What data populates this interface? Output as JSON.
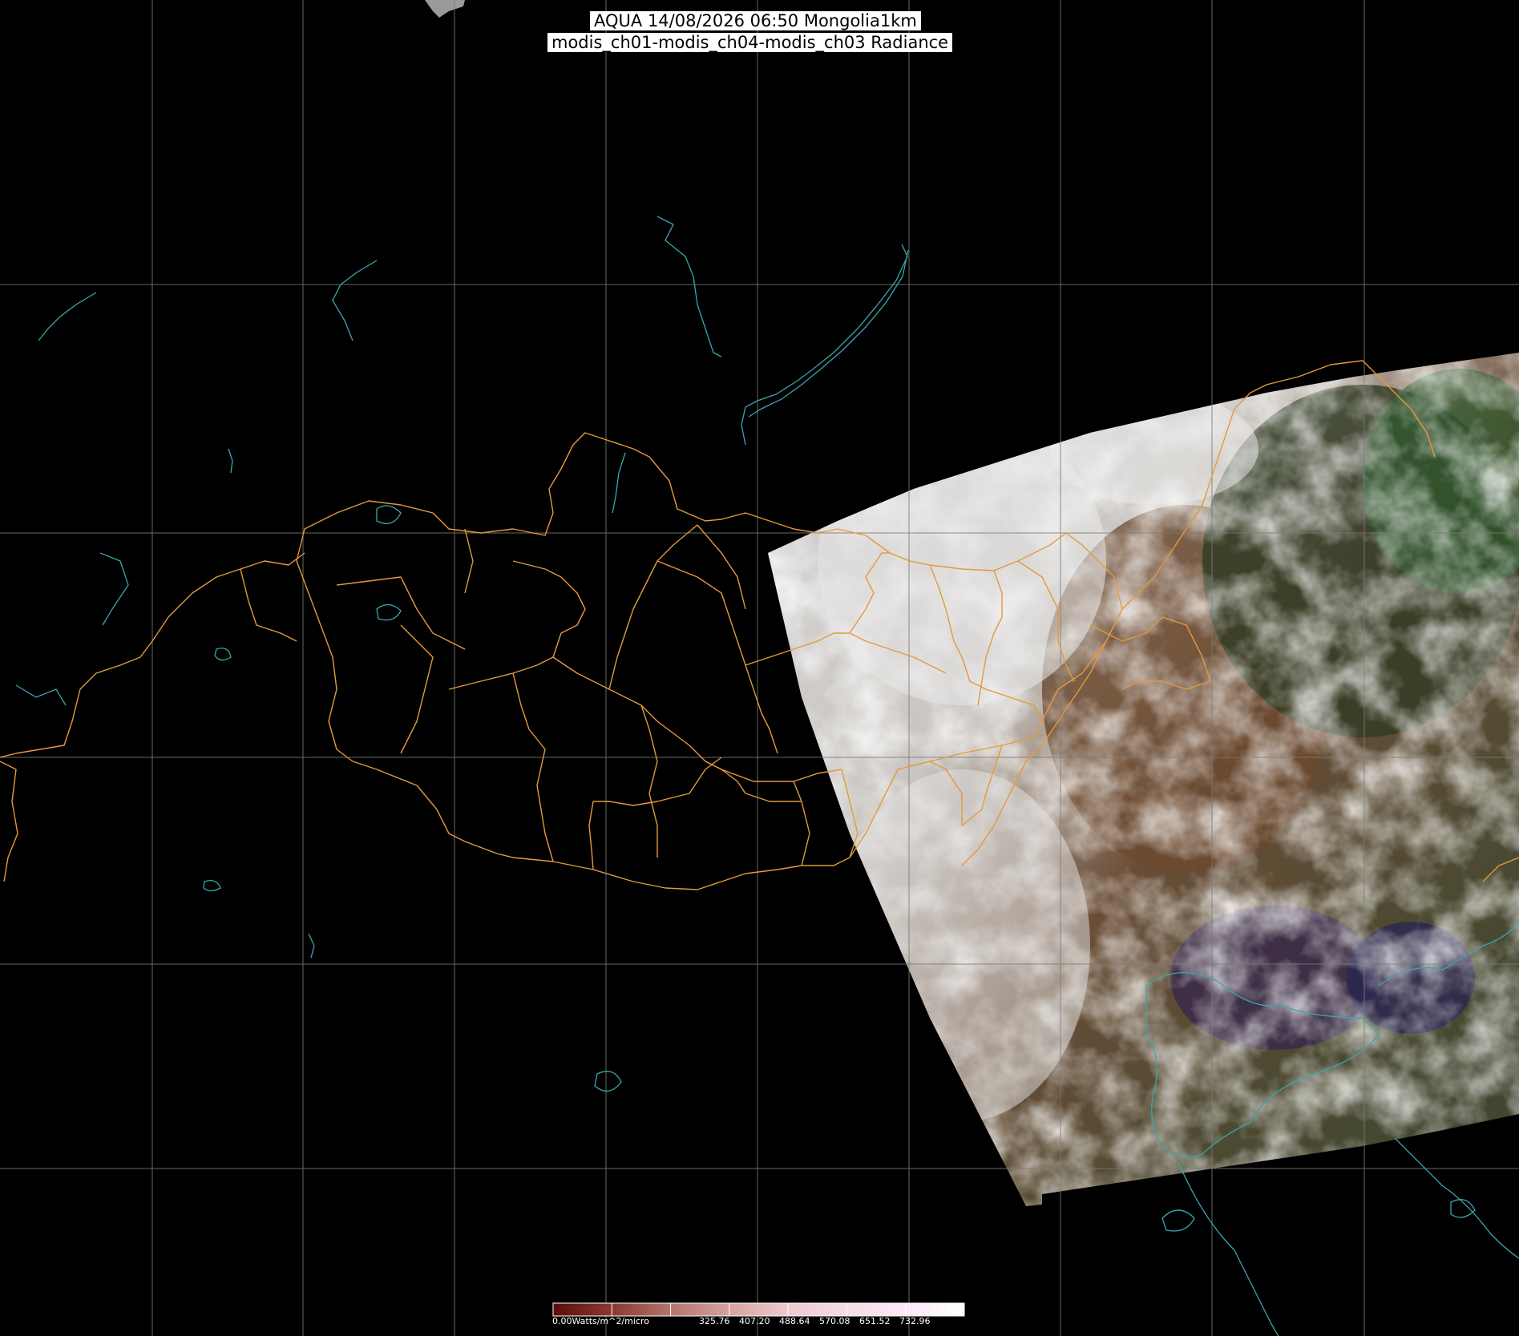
{
  "title": {
    "line1": "AQUA 14/08/2026 06:50 Mongolia1km",
    "line2": "modis_ch01-modis_ch04-modis_ch03 Radiance"
  },
  "colorbar": {
    "unit_label": "0.00Watts/m^2/micro",
    "ticks": [
      "325.76",
      "407.20",
      "488.64",
      "570.08",
      "651.52",
      "732.96"
    ],
    "colors": [
      "#5a0c08",
      "#8a3a30",
      "#b4756c",
      "#d6a3a0",
      "#efc9cf",
      "#f6dbe6",
      "#fde9f7",
      "#ffffff"
    ]
  },
  "map_colors": {
    "background": "#000000",
    "graticule": "#7a7a7a",
    "borders": "#e39a3d",
    "water": "#3aa6b0"
  }
}
